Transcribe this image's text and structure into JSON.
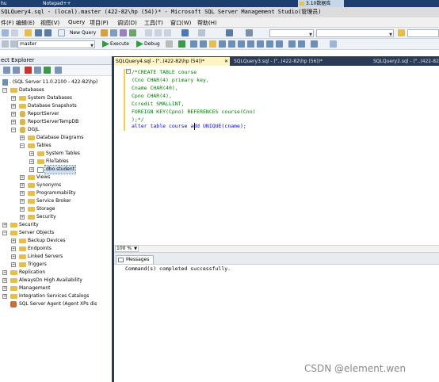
{
  "taskbar": {
    "left_label": "hu",
    "left_label2": "Notepad++",
    "folder_label": "3.10数据库"
  },
  "window": {
    "title": "SQLQuery4.sql - (local).master (422-82\\hp (54))* - Microsoft SQL Server Management Studio(管理员)"
  },
  "menu": {
    "items": [
      "件(F)",
      "编辑(E)",
      "视图(V)",
      "Query",
      "项目(P)",
      "调试(D)",
      "工具(T)",
      "窗口(W)",
      "帮助(H)"
    ]
  },
  "toolbar": {
    "new_query_label": "New Query",
    "database_selected": "master",
    "execute_label": "Execute",
    "debug_label": "Debug"
  },
  "object_explorer": {
    "title": "ect Explorer",
    "items": [
      {
        "label": ". (SQL Server 11.0.2100 - 422-82\\hp)"
      },
      {
        "label": "Databases"
      },
      {
        "label": "System Databases"
      },
      {
        "label": "Database Snapshots"
      },
      {
        "label": "ReportServer"
      },
      {
        "label": "ReportServerTempDB"
      },
      {
        "label": "DGJL"
      },
      {
        "label": "Database Diagrams"
      },
      {
        "label": "Tables"
      },
      {
        "label": "System Tables"
      },
      {
        "label": "FileTables"
      },
      {
        "label": "dbo.student"
      },
      {
        "label": "Views"
      },
      {
        "label": "Synonyms"
      },
      {
        "label": "Programmability"
      },
      {
        "label": "Service Broker"
      },
      {
        "label": "Storage"
      },
      {
        "label": "Security"
      },
      {
        "label": "Security"
      },
      {
        "label": "Server Objects"
      },
      {
        "label": "Backup Devices"
      },
      {
        "label": "Endpoints"
      },
      {
        "label": "Linked Servers"
      },
      {
        "label": "Triggers"
      },
      {
        "label": "Replication"
      },
      {
        "label": "AlwaysOn High Availability"
      },
      {
        "label": "Management"
      },
      {
        "label": "Integration Services Catalogs"
      },
      {
        "label": "SQL Server Agent (Agent XPs dis"
      }
    ]
  },
  "tabs": [
    {
      "label": "SQLQuery4.sql - (\"..(422-82\\hp (54))*"
    },
    {
      "label": "SQLQuery3.sql - (\"..(422-82\\hp (56))*"
    },
    {
      "label": "SQLQuery2.sql - (\"..(422-82\\hp"
    }
  ],
  "editor": {
    "lines": [
      "/*CREATE TABLE course",
      "(Cno CHAR(4) primary key,",
      "Cname CHAR(40),",
      "Cpno CHAR(4),",
      "Ccredit SMALLINT,",
      "FOREIGN KEY(Cpno) REFERENCES course(Cno)",
      ");*/",
      "alter table course add UNIQUE(cname);"
    ],
    "zoom": "100 %"
  },
  "results": {
    "tab_label": "Messages",
    "message": "Command(s) completed successfully."
  },
  "watermark": "CSDN @element.wen",
  "colors": {
    "keyword": "#0000ff",
    "comment": "#008000",
    "accent": "#2b3a55",
    "active_tab": "#fff4c2"
  }
}
